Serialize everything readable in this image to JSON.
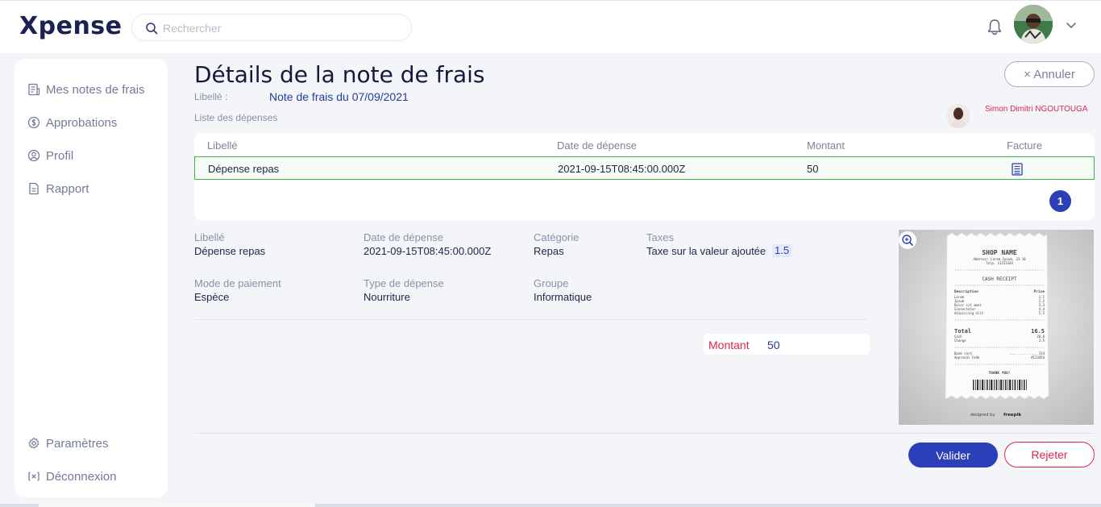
{
  "app": {
    "logo": "Xpense"
  },
  "search": {
    "placeholder": "Rechercher"
  },
  "header": {
    "notifications_icon": "bell-icon",
    "avatar_icon": "user-avatar",
    "menu_icon": "chevron-down-icon"
  },
  "sidebar": {
    "items": [
      {
        "label": "Mes notes de frais",
        "icon": "receipt-list-icon"
      },
      {
        "label": "Approbations",
        "icon": "dollar-circle-icon"
      },
      {
        "label": "Profil",
        "icon": "user-circle-icon"
      },
      {
        "label": "Rapport",
        "icon": "document-icon"
      }
    ],
    "bottom_items": [
      {
        "label": "Paramètres",
        "icon": "gear-icon"
      },
      {
        "label": "Déconnexion",
        "icon": "logout-icon"
      }
    ]
  },
  "page": {
    "title": "Détails de la note de frais",
    "libelle_label": "Libellé :",
    "libelle_value": "Note de frais du 07/09/2021",
    "expenses_list_label": "Liste des dépenses",
    "cancel_label": "× Annuler",
    "submitter_name": "Simon Dimitri NGOUTOUGA"
  },
  "expenses_table": {
    "headers": [
      "Libellé",
      "Date de dépense",
      "Montant",
      "Facture"
    ],
    "rows": [
      {
        "libelle": "Dépense repas",
        "date": "2021-09-15T08:45:00.000Z",
        "montant": "50",
        "facture_icon": "receipt-icon"
      }
    ],
    "current_page": "1"
  },
  "details": {
    "libelle_label": "Libellé",
    "libelle_value": "Dépense repas",
    "date_label": "Date de dépense",
    "date_value": "2021-09-15T08:45:00.000Z",
    "categorie_label": "Catégorie",
    "categorie_value": "Repas",
    "taxes_label": "Taxes",
    "taxes_value": "Taxe sur la valeur ajoutée",
    "taxes_rate": "1.5",
    "mode_label": "Mode de paiement",
    "mode_value": "Espèce",
    "type_label": "Type de dépense",
    "type_value": "Nourriture",
    "groupe_label": "Groupe",
    "groupe_value": "Informatique",
    "montant_label": "Montant",
    "montant_value": "50"
  },
  "invoice_image": {
    "zoom_icon": "zoom-in-icon",
    "shop_name": "SHOP NAME",
    "address": "Address: Lorem Ipsum, 23-10",
    "telp": "Telp. 11223344",
    "title": "CASH RECEIPT",
    "col_description": "Description",
    "col_price": "Price",
    "items": [
      {
        "name": "Lorem",
        "price": "1.1"
      },
      {
        "name": "Ipsum",
        "price": "2.2"
      },
      {
        "name": "Dolor sit amet",
        "price": "3.3"
      },
      {
        "name": "Consectetur",
        "price": "4.4"
      },
      {
        "name": "Adipiscing elit",
        "price": "5.5"
      }
    ],
    "total_label": "Total",
    "total_value": "16.5",
    "cash_label": "Cash",
    "cash_value": "20.0",
    "change_label": "Change",
    "change_value": "3.5",
    "bank_label": "Bank card",
    "bank_value": ".... .... .... 234",
    "approval_label": "Approval Code",
    "approval_value": "#123456",
    "thanks": "THANK YOU!",
    "credit": "designed by",
    "credit_brand": "freepik"
  },
  "actions": {
    "validate_label": "Valider",
    "reject_label": "Rejeter"
  }
}
